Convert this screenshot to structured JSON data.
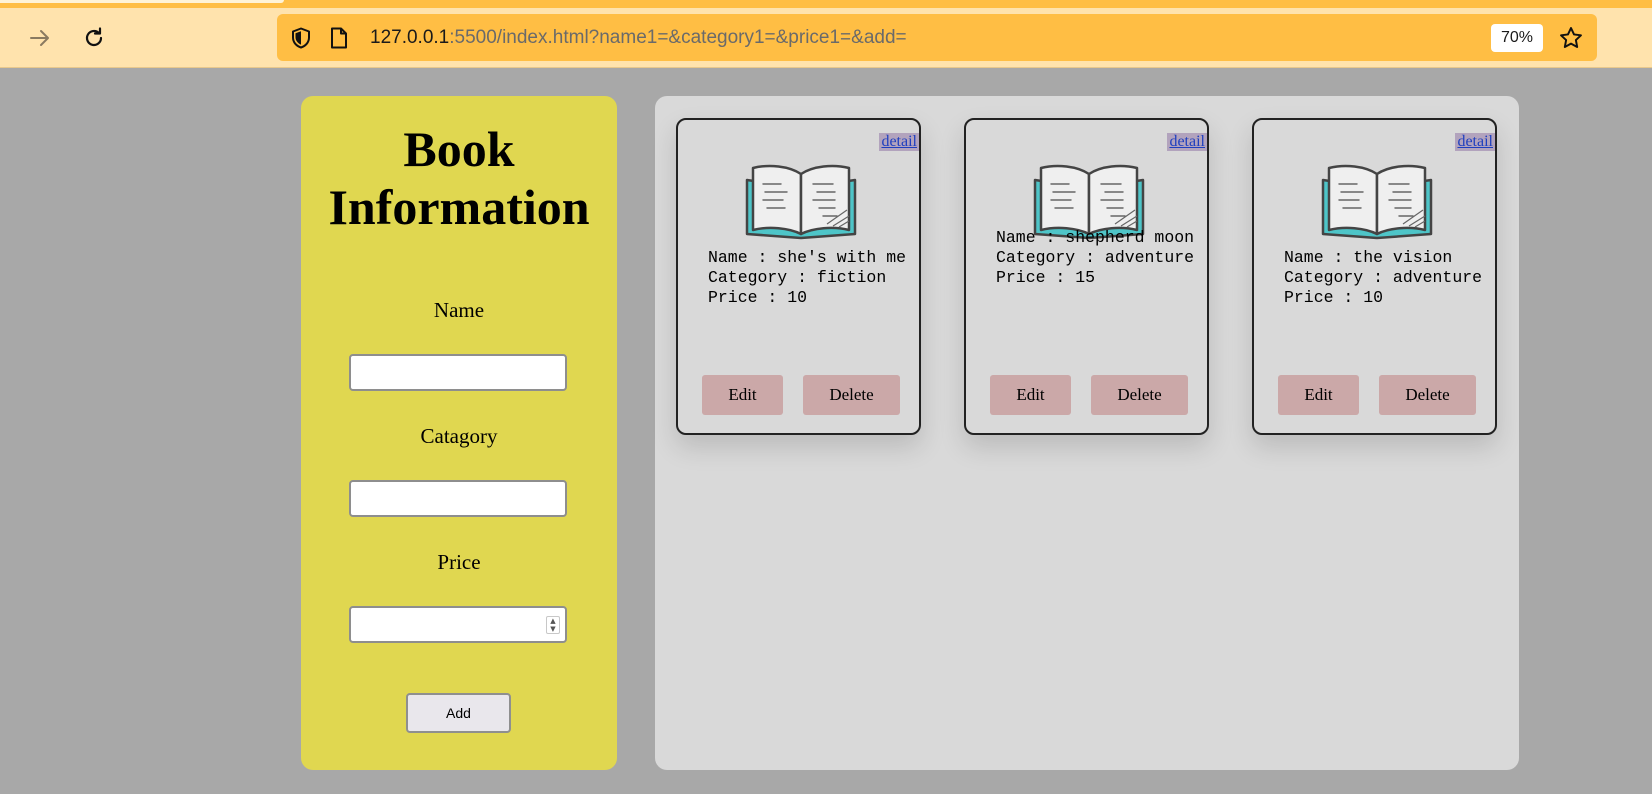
{
  "browser": {
    "url_host": "127.0.0.1",
    "url_rest": ":5500/index.html?name1=&category1=&price1=&add=",
    "zoom": "70%"
  },
  "form": {
    "title_line1": "Book",
    "title_line2": "Information",
    "name_label": "Name",
    "category_label": "Catagory",
    "price_label": "Price",
    "add_label": "Add"
  },
  "cards": [
    {
      "detail": "detail",
      "name_line": "Name : she's with me",
      "category_line": "Category : fiction",
      "price_line": "Price : 10",
      "edit": "Edit",
      "delete": "Delete"
    },
    {
      "detail": "detail",
      "name_line": "Name : shepherd moon",
      "category_line": "Category : adventure",
      "price_line": "Price : 15",
      "edit": "Edit",
      "delete": "Delete"
    },
    {
      "detail": "detail",
      "name_line": "Name : the vision",
      "category_line": "Category : adventure",
      "price_line": "Price : 10",
      "edit": "Edit",
      "delete": "Delete"
    }
  ],
  "colors": {
    "form_panel": "#e0d750",
    "button": "#cba8a8",
    "toolbar": "#ffe3ad",
    "urlbar": "#ffbe44"
  }
}
